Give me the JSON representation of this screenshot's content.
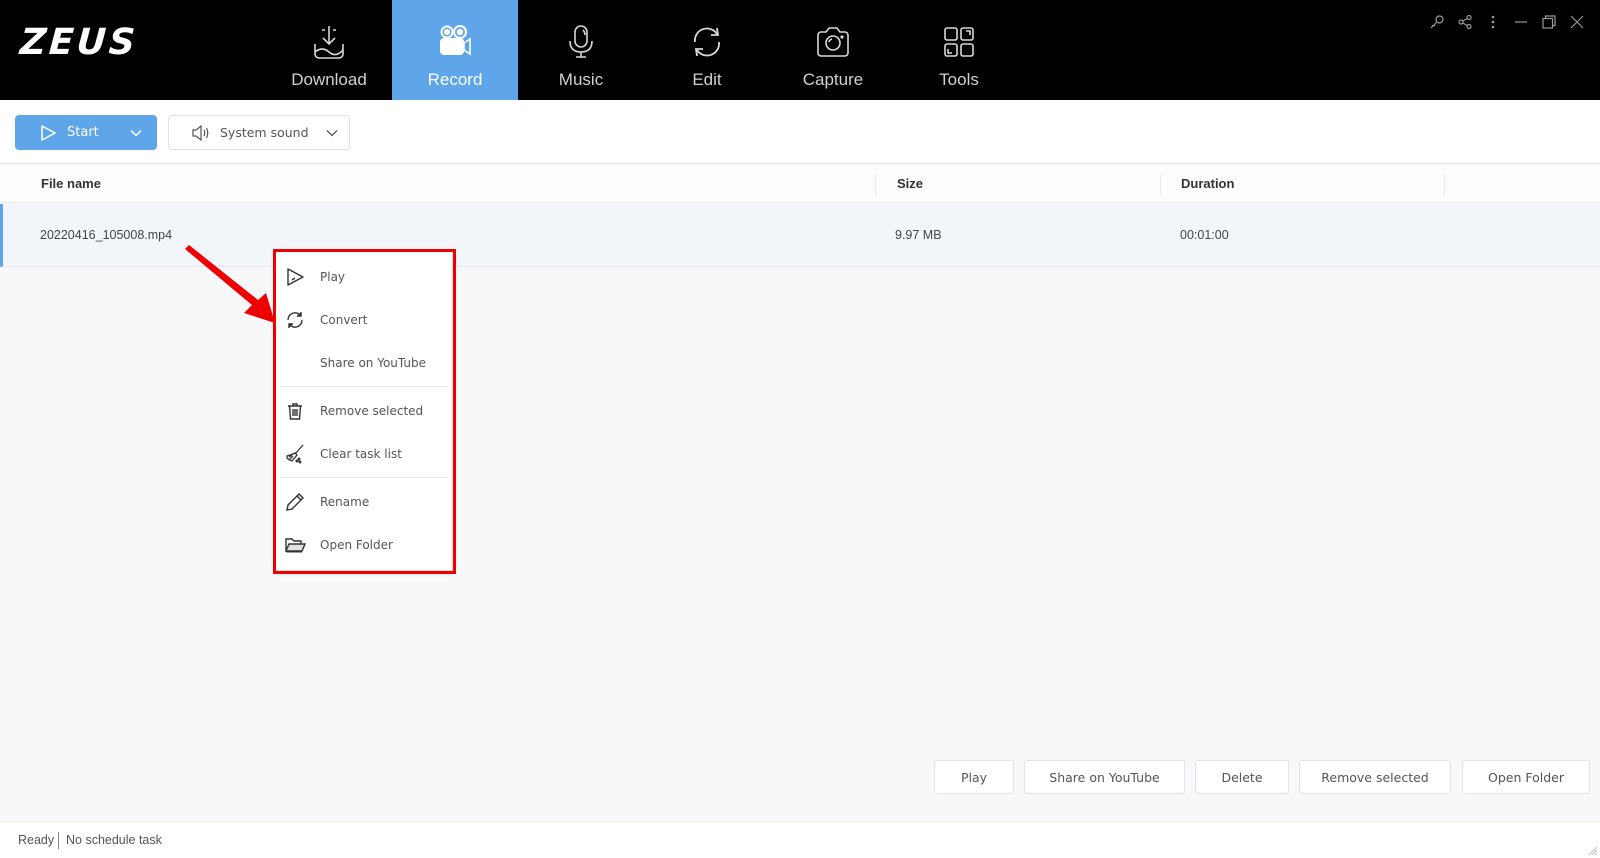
{
  "app": {
    "logo": "ZEUS",
    "accent_color": "#5ea6e9",
    "highlight_color": "#ee0000"
  },
  "nav": {
    "items": [
      {
        "label": "Download",
        "icon": "download-icon",
        "active": false
      },
      {
        "label": "Record",
        "icon": "video-camera-icon",
        "active": true
      },
      {
        "label": "Music",
        "icon": "microphone-icon",
        "active": false
      },
      {
        "label": "Edit",
        "icon": "convert-cycle-icon",
        "active": false
      },
      {
        "label": "Capture",
        "icon": "camera-icon",
        "active": false
      },
      {
        "label": "Tools",
        "icon": "grid-tools-icon",
        "active": false
      }
    ]
  },
  "window_controls": [
    "key-icon",
    "share-icon",
    "more-vertical-icon",
    "minimize-icon",
    "restore-icon",
    "close-icon"
  ],
  "toolbar": {
    "start_label": "Start",
    "sound_label": "System sound"
  },
  "table": {
    "columns": [
      "File name",
      "Size",
      "Duration"
    ],
    "rows": [
      {
        "file_name": "20220416_105008.mp4",
        "size": "9.97 MB",
        "duration": "00:01:00",
        "selected": true
      }
    ]
  },
  "context_menu": {
    "items": [
      {
        "label": "Play",
        "icon": "play-icon"
      },
      {
        "label": "Convert",
        "icon": "convert-icon"
      },
      {
        "label": "Share on YouTube",
        "icon": ""
      },
      {
        "label": "Remove selected",
        "icon": "trash-icon"
      },
      {
        "label": "Clear task list",
        "icon": "broom-icon"
      },
      {
        "label": "Rename",
        "icon": "pencil-icon"
      },
      {
        "label": "Open Folder",
        "icon": "folder-open-icon"
      }
    ]
  },
  "actions": {
    "buttons": [
      "Play",
      "Share on YouTube",
      "Delete",
      "Remove selected",
      "Open Folder"
    ]
  },
  "status": {
    "state": "Ready",
    "schedule": "No schedule task"
  }
}
